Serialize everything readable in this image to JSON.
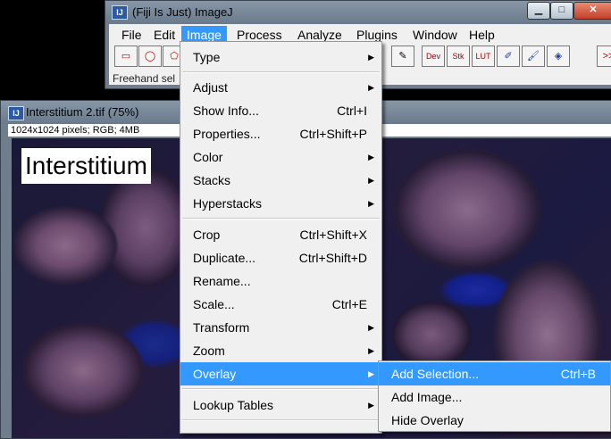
{
  "fiji_window": {
    "title": "(Fiji Is Just) ImageJ",
    "icon_text": "IJ",
    "controls": {
      "minimize": "▁",
      "maximize": "□",
      "close": "✕"
    },
    "menu": [
      "File",
      "Edit",
      "Image",
      "Process",
      "Analyze",
      "Plugins",
      "Window",
      "Help"
    ],
    "active_menu": "Image",
    "toolbar_right": [
      "Dev",
      "Stk",
      "LUT",
      ">>"
    ],
    "status": "Freehand sel"
  },
  "image_window": {
    "title": "Interstitium 2.tif (75%)",
    "icon_text": "IJ",
    "info": "1024x1024 pixels; RGB; 4MB",
    "label": "Interstitium"
  },
  "image_menu": {
    "items": [
      {
        "label": "Type",
        "submenu": true
      },
      {
        "label": "Adjust",
        "submenu": true
      },
      {
        "label": "Show Info...",
        "shortcut": "Ctrl+I"
      },
      {
        "label": "Properties...",
        "shortcut": "Ctrl+Shift+P"
      },
      {
        "label": "Color",
        "submenu": true
      },
      {
        "label": "Stacks",
        "submenu": true
      },
      {
        "label": "Hyperstacks",
        "submenu": true
      },
      {
        "label": "Crop",
        "shortcut": "Ctrl+Shift+X"
      },
      {
        "label": "Duplicate...",
        "shortcut": "Ctrl+Shift+D"
      },
      {
        "label": "Rename..."
      },
      {
        "label": "Scale...",
        "shortcut": "Ctrl+E"
      },
      {
        "label": "Transform",
        "submenu": true
      },
      {
        "label": "Zoom",
        "submenu": true
      },
      {
        "label": "Overlay",
        "submenu": true,
        "highlighted": true
      },
      {
        "label": "Lookup Tables",
        "submenu": true
      }
    ]
  },
  "overlay_menu": {
    "items": [
      {
        "label": "Add Selection...",
        "shortcut": "Ctrl+B",
        "highlighted": true
      },
      {
        "label": "Add Image..."
      },
      {
        "label": "Hide Overlay"
      }
    ]
  },
  "colors": {
    "highlight": "#3399ff",
    "menu_bg": "#f0f0f0",
    "titlebar": "#7a8a9b"
  }
}
